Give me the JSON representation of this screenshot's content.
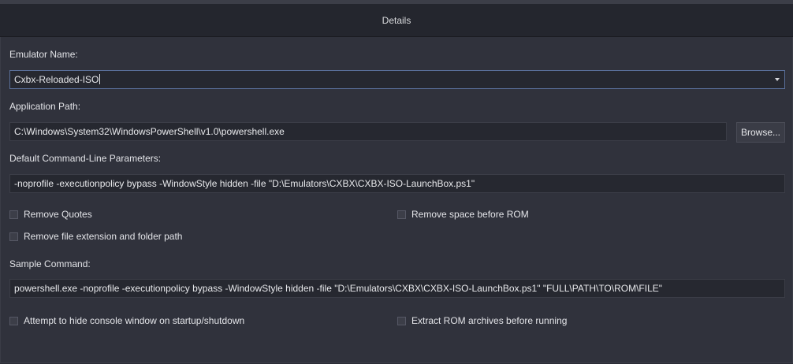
{
  "header": {
    "title": "Details"
  },
  "emulator_name": {
    "label": "Emulator Name:",
    "value": "Cxbx-Reloaded-ISO"
  },
  "application_path": {
    "label": "Application Path:",
    "value": "C:\\Windows\\System32\\WindowsPowerShell\\v1.0\\powershell.exe",
    "browse_label": "Browse..."
  },
  "default_params": {
    "label": "Default Command-Line Parameters:",
    "value": "-noprofile -executionpolicy bypass -WindowStyle hidden -file \"D:\\Emulators\\CXBX\\CXBX-ISO-LaunchBox.ps1\""
  },
  "options": {
    "remove_quotes": "Remove Quotes",
    "remove_space": "Remove space before ROM",
    "remove_extension": "Remove file extension and folder path"
  },
  "sample_command": {
    "label": "Sample Command:",
    "value": "powershell.exe -noprofile -executionpolicy bypass -WindowStyle hidden -file \"D:\\Emulators\\CXBX\\CXBX-ISO-LaunchBox.ps1\" \"FULL\\PATH\\TO\\ROM\\FILE\""
  },
  "bottom_options": {
    "hide_console": "Attempt to hide console window on startup/shutdown",
    "extract_archives": "Extract ROM archives before running"
  },
  "colors": {
    "background": "#30323c",
    "header": "#24262e",
    "field": "#262830",
    "focus_border": "#5a6f9a"
  }
}
